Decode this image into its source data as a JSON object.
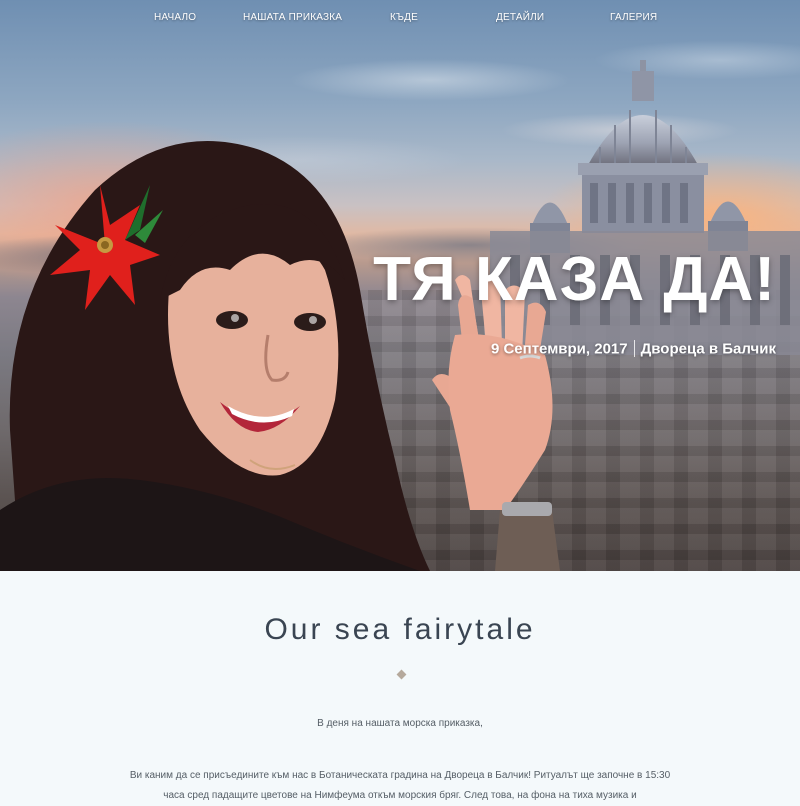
{
  "nav": {
    "items": [
      "НАЧАЛО",
      "НАШАТА ПРИКАЗКА",
      "КЪДЕ",
      "ДЕТАЙЛИ",
      "ГАЛЕРИЯ"
    ]
  },
  "hero": {
    "title": "ТЯ КАЗА ДА!",
    "date": "9 Септември, 2017",
    "venue": "Двореца в Балчик"
  },
  "section": {
    "title": "Our sea fairytale",
    "greeting": "В деня на нашата морска приказка,",
    "paragraph": "Ви каним да се присъедините към нас в Ботаническата градина на Двореца в Балчик! Ритуалът ще започне в 15:30 часа сред падащите цветове на Нимфеума откъм морския бряг. След това, на фона на тиха музика и"
  },
  "colors": {
    "accent_diamond": "#b5a99c",
    "heading_text": "#3a4552",
    "body_text": "#555e66",
    "content_background": "#f4f9fb"
  }
}
